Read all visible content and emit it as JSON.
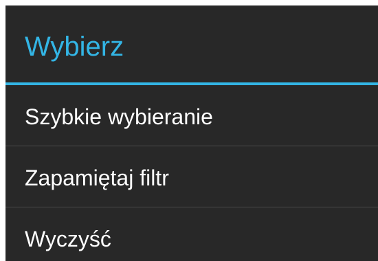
{
  "dialog": {
    "title": "Wybierz",
    "accent_color": "#33b5e5",
    "background_color": "#282828",
    "items": [
      {
        "label": "Szybkie wybieranie"
      },
      {
        "label": "Zapamiętaj filtr"
      },
      {
        "label": "Wyczyść"
      }
    ]
  }
}
